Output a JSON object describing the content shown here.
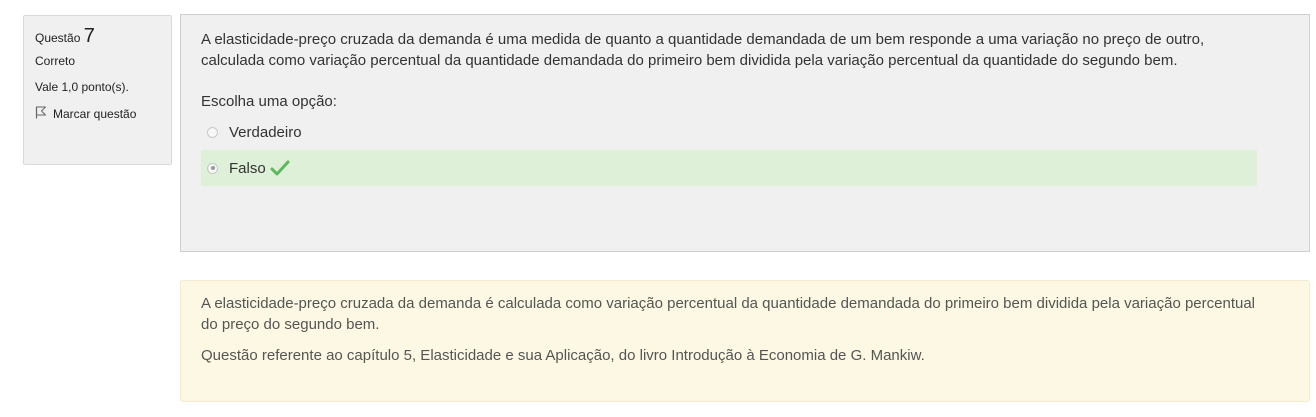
{
  "info": {
    "question_label": "Questão",
    "question_number": "7",
    "state": "Correto",
    "grade": "Vale 1,0 ponto(s).",
    "flag_label": "Marcar questão"
  },
  "question": {
    "text": "A elasticidade-preço cruzada da demanda é uma medida de quanto a quantidade demandada de um bem responde a uma variação no preço de outro, calculada como variação percentual da quantidade demandada do primeiro bem dividida pela variação percentual da quantidade do segundo bem.",
    "prompt": "Escolha uma opção:",
    "options": [
      {
        "label": "Verdadeiro",
        "selected": false,
        "correct": false
      },
      {
        "label": "Falso",
        "selected": true,
        "correct": true
      }
    ]
  },
  "feedback": {
    "paragraph1": "A elasticidade-preço cruzada da demanda é calculada como variação percentual da quantidade demandada do primeiro bem dividida pela variação percentual do preço do segundo bem.",
    "paragraph2": "Questão referente ao capítulo 5, Elasticidade e sua Aplicação, do livro Introdução à Economia de G. Mankiw."
  },
  "colors": {
    "correct_bg": "#dff0d8",
    "check": "#5cb85c",
    "feedback_bg": "#fcf8e3"
  },
  "icons": [
    "flag-icon",
    "check-icon"
  ]
}
